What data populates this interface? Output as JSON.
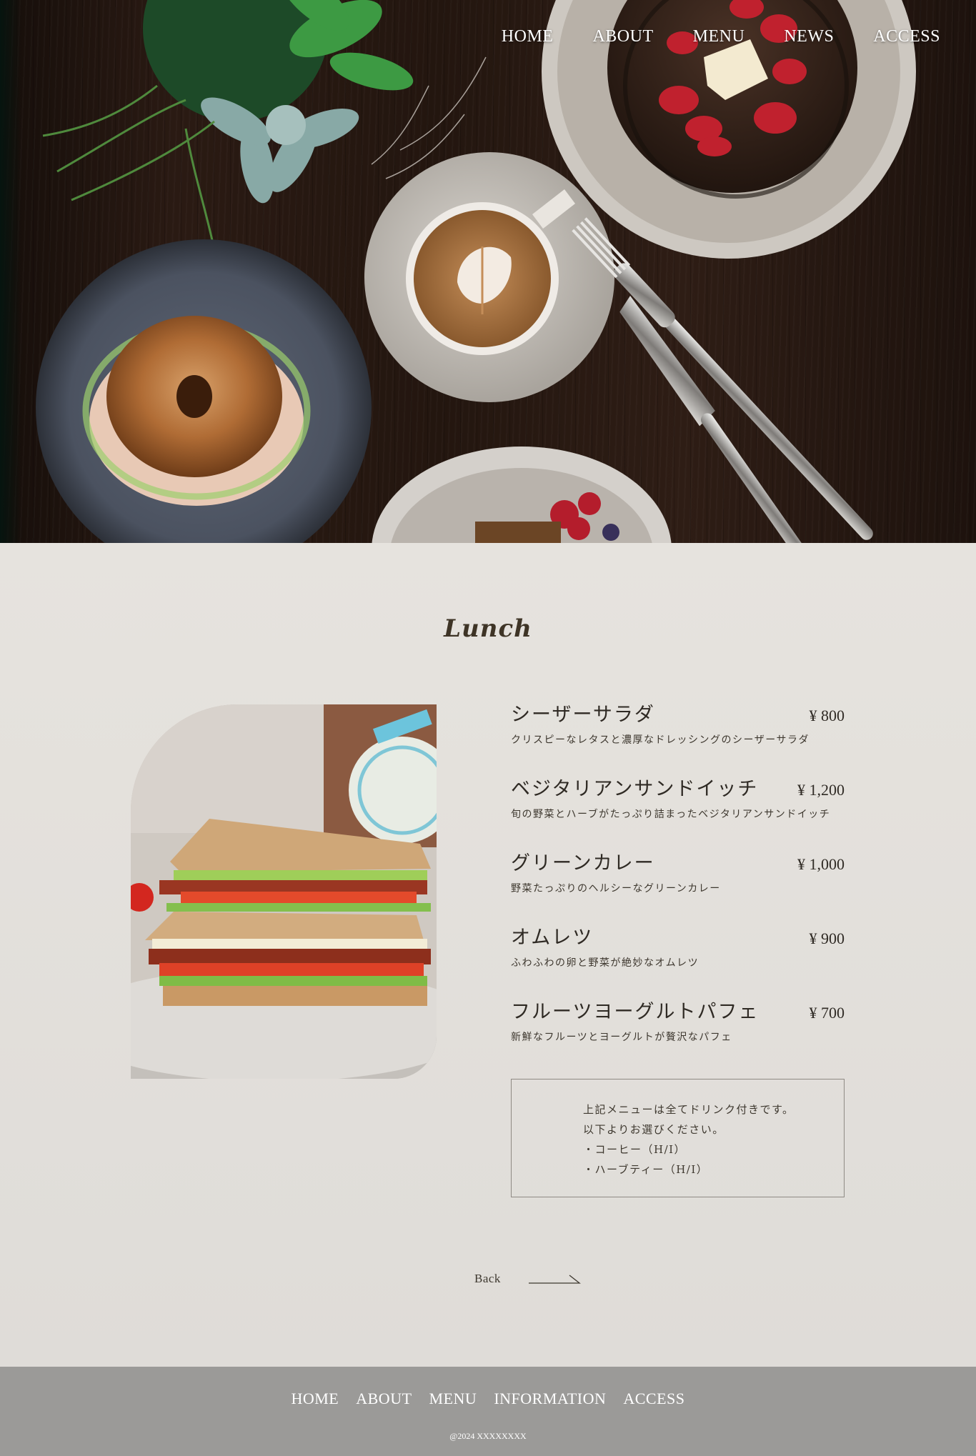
{
  "header": {
    "nav": [
      "HOME",
      "ABOUT",
      "MENU",
      "NEWS",
      "ACCESS"
    ]
  },
  "lunch": {
    "title": "Lunch",
    "photo_alt": "sandwich-photo",
    "items": [
      {
        "name": "シーザーサラダ",
        "price": "¥ 800",
        "desc": "クリスピーなレタスと濃厚なドレッシングのシーザーサラダ"
      },
      {
        "name": "ベジタリアンサンドイッチ",
        "price": "¥ 1,200",
        "desc": "旬の野菜とハーブがたっぷり詰まったベジタリアンサンドイッチ"
      },
      {
        "name": "グリーンカレー",
        "price": "¥ 1,000",
        "desc": "野菜たっぷりのヘルシーなグリーンカレー"
      },
      {
        "name": "オムレツ",
        "price": "¥ 900",
        "desc": "ふわふわの卵と野菜が絶妙なオムレツ"
      },
      {
        "name": "フルーツヨーグルトパフェ",
        "price": "¥ 700",
        "desc": "新鮮なフルーツとヨーグルトが贅沢なパフェ"
      }
    ],
    "note": [
      "上記メニューは全てドリンク付きです。",
      "以下よりお選びください。",
      "・コーヒー（H/I）",
      "・ハーブティー（H/I）"
    ],
    "back_label": "Back"
  },
  "footer": {
    "nav": [
      "HOME",
      "ABOUT",
      "MENU",
      "INFORMATION",
      "ACCESS"
    ],
    "copyright": "@2024 XXXXXXXX"
  },
  "colors": {
    "background": "#e2dfdb",
    "footer": "#9b9a98",
    "text": "#3a352f"
  }
}
